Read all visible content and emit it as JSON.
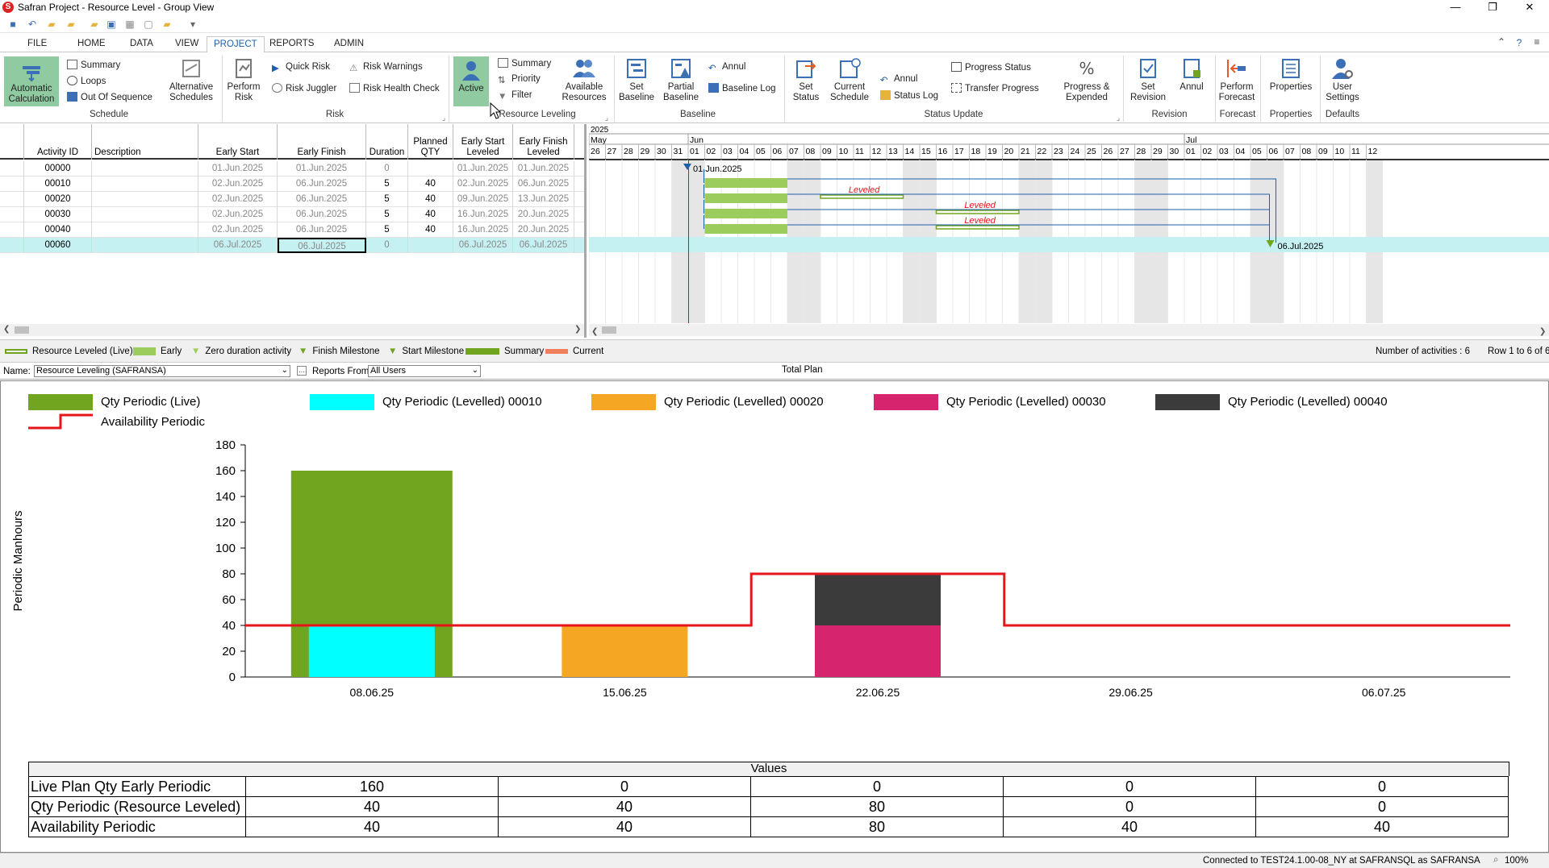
{
  "window": {
    "title": "Safran Project - Resource Level - Group View",
    "min": "—",
    "max": "❐",
    "close": "✕"
  },
  "tabs": [
    {
      "label": "FILE"
    },
    {
      "label": "HOME"
    },
    {
      "label": "DATA"
    },
    {
      "label": "VIEW"
    },
    {
      "label": "PROJECT"
    },
    {
      "label": "REPORTS"
    },
    {
      "label": "ADMIN"
    }
  ],
  "ribbon": {
    "schedule": {
      "group": "Schedule",
      "auto_calc": "Automatic Calculation",
      "summary": "Summary",
      "loops": "Loops",
      "out_of_sequence": "Out Of Sequence",
      "alt_schedules": "Alternative Schedules"
    },
    "risk": {
      "group": "Risk",
      "perform_risk": "Perform Risk",
      "quick_risk": "Quick Risk",
      "risk_juggler": "Risk Juggler",
      "risk_warnings": "Risk Warnings",
      "risk_health": "Risk Health Check"
    },
    "leveling": {
      "group": "Resource Leveling",
      "active": "Active",
      "summary": "Summary",
      "priority": "Priority",
      "filter": "Filter",
      "available": "Available Resources"
    },
    "baseline": {
      "group": "Baseline",
      "set": "Set Baseline",
      "partial": "Partial Baseline",
      "annul": "Annul",
      "log": "Baseline Log"
    },
    "status": {
      "group": "Status Update",
      "set": "Set Status",
      "current": "Current Schedule",
      "annul": "Annul",
      "log": "Status Log",
      "progress_status": "Progress Status",
      "transfer": "Transfer Progress",
      "progress_expended": "Progress & Expended"
    },
    "revision": {
      "group": "Revision",
      "set": "Set Revision",
      "annul": "Annul"
    },
    "forecast": {
      "group": "Forecast",
      "perform": "Perform Forecast"
    },
    "properties": {
      "group": "Properties",
      "btn": "Properties"
    },
    "defaults": {
      "group": "Defaults",
      "user": "User Settings"
    }
  },
  "grid": {
    "headers": [
      "Activity ID",
      "Description",
      "Early Start",
      "Early Finish",
      "Duration",
      "Planned QTY",
      "Early Start Leveled",
      "Early Finish Leveled"
    ],
    "rows": [
      {
        "id": "00000",
        "desc": "",
        "es": "01.Jun.2025",
        "ef": "01.Jun.2025",
        "dur": "0",
        "qty": "",
        "esl": "01.Jun.2025",
        "efl": "01.Jun.2025"
      },
      {
        "id": "00010",
        "desc": "",
        "es": "02.Jun.2025",
        "ef": "06.Jun.2025",
        "dur": "5",
        "qty": "40",
        "esl": "02.Jun.2025",
        "efl": "06.Jun.2025"
      },
      {
        "id": "00020",
        "desc": "",
        "es": "02.Jun.2025",
        "ef": "06.Jun.2025",
        "dur": "5",
        "qty": "40",
        "esl": "09.Jun.2025",
        "efl": "13.Jun.2025"
      },
      {
        "id": "00030",
        "desc": "",
        "es": "02.Jun.2025",
        "ef": "06.Jun.2025",
        "dur": "5",
        "qty": "40",
        "esl": "16.Jun.2025",
        "efl": "20.Jun.2025"
      },
      {
        "id": "00040",
        "desc": "",
        "es": "02.Jun.2025",
        "ef": "06.Jun.2025",
        "dur": "5",
        "qty": "40",
        "esl": "16.Jun.2025",
        "efl": "20.Jun.2025"
      },
      {
        "id": "00060",
        "desc": "",
        "es": "06.Jul.2025",
        "ef": "06.Jul.2025",
        "dur": "0",
        "qty": "",
        "esl": "06.Jul.2025",
        "efl": "06.Jul.2025"
      }
    ]
  },
  "gantt": {
    "year": "2025",
    "months": [
      "May",
      "Jun",
      "Jul"
    ],
    "days": [
      "26",
      "27",
      "28",
      "29",
      "30",
      "31",
      "01",
      "02",
      "03",
      "04",
      "05",
      "06",
      "07",
      "08",
      "09",
      "10",
      "11",
      "12",
      "13",
      "14",
      "15",
      "16",
      "17",
      "18",
      "19",
      "20",
      "21",
      "22",
      "23",
      "24",
      "25",
      "26",
      "27",
      "28",
      "29",
      "30",
      "01",
      "02",
      "03",
      "04",
      "05",
      "06",
      "07",
      "08",
      "09",
      "10",
      "11",
      "12"
    ],
    "leveled_label": "Leveled",
    "start_milestone": "01.Jun.2025",
    "finish_milestone": "06.Jul.2025"
  },
  "legend": {
    "items": [
      "Resource Leveled (Live)",
      "Early",
      "Zero duration activity",
      "Finish Milestone",
      "Start Milestone",
      "Summary",
      "Current"
    ],
    "num_activities": "Number of activities : 6",
    "rows": "Row 1 to 6 of 6"
  },
  "report": {
    "name_label": "Name:",
    "name_value": "Resource Leveling (SAFRANSA)",
    "reports_from_label": "Reports From:",
    "reports_from_value": "All Users",
    "plan": "Total Plan"
  },
  "colors": {
    "live": "#72a51f",
    "l00010": "#00ffff",
    "l00020": "#f5a623",
    "l00030": "#d6246e",
    "l00040": "#3b3b3b",
    "avail": "#e8141c"
  },
  "chart_data": {
    "type": "bar",
    "ylabel": "Periodic Manhours",
    "ylim": [
      0,
      180
    ],
    "yticks": [
      0,
      20,
      40,
      60,
      80,
      100,
      120,
      140,
      160,
      180
    ],
    "categories": [
      "08.06.25",
      "15.06.25",
      "22.06.25",
      "29.06.25",
      "06.07.25"
    ],
    "series": [
      {
        "name": "Qty Periodic (Live)",
        "values": [
          160,
          0,
          0,
          0,
          0
        ]
      },
      {
        "name": "Qty Periodic (Levelled) 00010",
        "values": [
          40,
          0,
          0,
          0,
          0
        ]
      },
      {
        "name": "Qty Periodic (Levelled) 00020",
        "values": [
          0,
          40,
          0,
          0,
          0
        ]
      },
      {
        "name": "Qty Periodic (Levelled) 00030",
        "values": [
          0,
          0,
          40,
          0,
          0
        ]
      },
      {
        "name": "Qty Periodic (Levelled) 00040",
        "values": [
          0,
          0,
          40,
          0,
          0
        ]
      },
      {
        "name": "Availability Periodic",
        "values": [
          40,
          40,
          80,
          40,
          40
        ]
      }
    ],
    "table": {
      "header": "Values",
      "rows": [
        {
          "label": "Live Plan Qty Early Periodic",
          "values": [
            "160",
            "0",
            "0",
            "0",
            "0"
          ]
        },
        {
          "label": "Qty Periodic (Resource Leveled)",
          "values": [
            "40",
            "40",
            "80",
            "0",
            "0"
          ]
        },
        {
          "label": "Availability Periodic",
          "values": [
            "40",
            "40",
            "80",
            "40",
            "40"
          ]
        }
      ]
    }
  },
  "status": {
    "connection": "Connected to TEST24.1.00-08_NY at SAFRANSQL as SAFRANSA",
    "zoom": "100%"
  }
}
